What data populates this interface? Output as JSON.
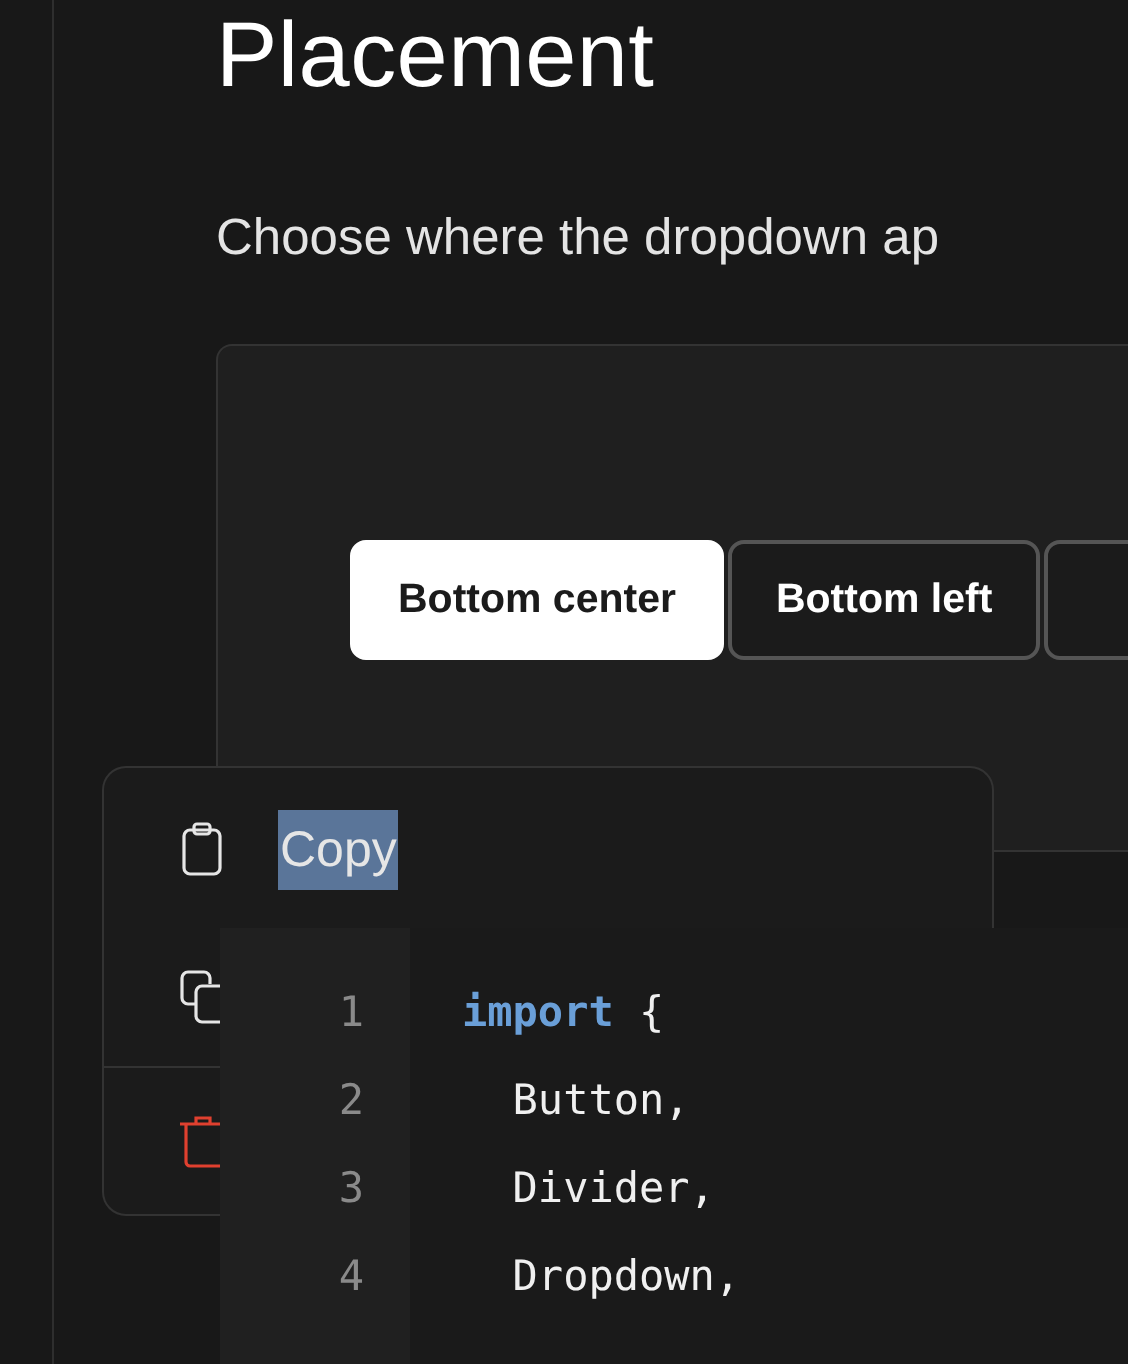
{
  "heading": "Placement",
  "description": "Choose where the dropdown ap",
  "placement_buttons": [
    {
      "label": "Bottom center",
      "selected": true
    },
    {
      "label": "Bottom left",
      "selected": false
    },
    {
      "selected": false
    }
  ],
  "menu": {
    "items": [
      {
        "kind": "clipboard",
        "label": "Copy",
        "text_selected": true
      },
      {
        "kind": "copy"
      },
      {
        "kind": "trash"
      }
    ]
  },
  "code": {
    "lines": [
      {
        "number": "1",
        "tokens": [
          {
            "kind": "keyword",
            "text": "import"
          },
          {
            "kind": "plain",
            "text": " {"
          }
        ]
      },
      {
        "number": "2",
        "tokens": [
          {
            "kind": "plain",
            "text": "  Button,"
          }
        ]
      },
      {
        "number": "3",
        "tokens": [
          {
            "kind": "plain",
            "text": "  Divider,"
          }
        ]
      },
      {
        "number": "4",
        "tokens": [
          {
            "kind": "plain",
            "text": "  Dropdown,"
          }
        ]
      }
    ]
  }
}
